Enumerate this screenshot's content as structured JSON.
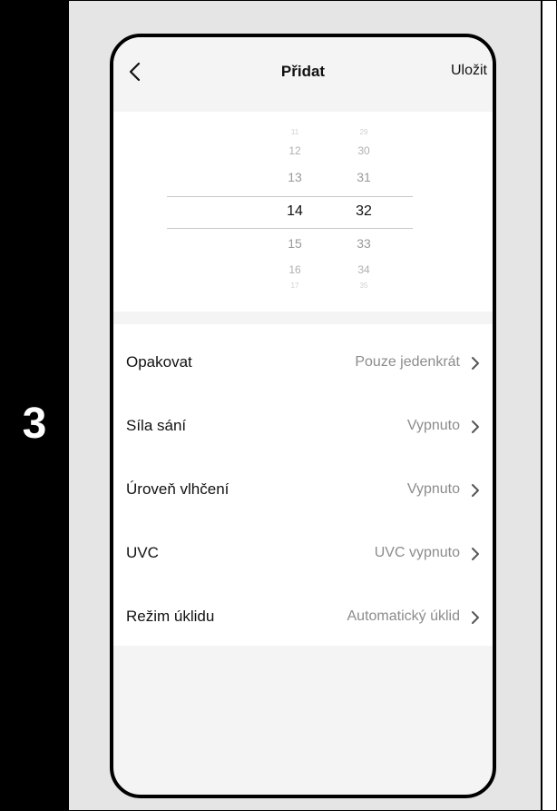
{
  "step": {
    "number": "3"
  },
  "nav": {
    "title": "Přidat",
    "save_label": "Uložit",
    "back_icon": "chevron-left-icon"
  },
  "picker": {
    "hours": [
      "11",
      "12",
      "13",
      "14",
      "15",
      "16",
      "17"
    ],
    "minutes": [
      "29",
      "30",
      "31",
      "32",
      "33",
      "34",
      "35"
    ],
    "selected_hour": "14",
    "selected_minute": "32"
  },
  "settings": [
    {
      "label": "Opakovat",
      "value": "Pouze jedenkrát"
    },
    {
      "label": "Síla sání",
      "value": "Vypnuto"
    },
    {
      "label": "Úroveň vlhčení",
      "value": "Vypnuto"
    },
    {
      "label": "UVC",
      "value": "UVC vypnuto"
    },
    {
      "label": "Režim úklidu",
      "value": "Automatický úklid"
    }
  ],
  "colors": {
    "step_bg": "#000000",
    "panel_bg": "#e5e5e5",
    "value_text": "#8c8c8c"
  }
}
